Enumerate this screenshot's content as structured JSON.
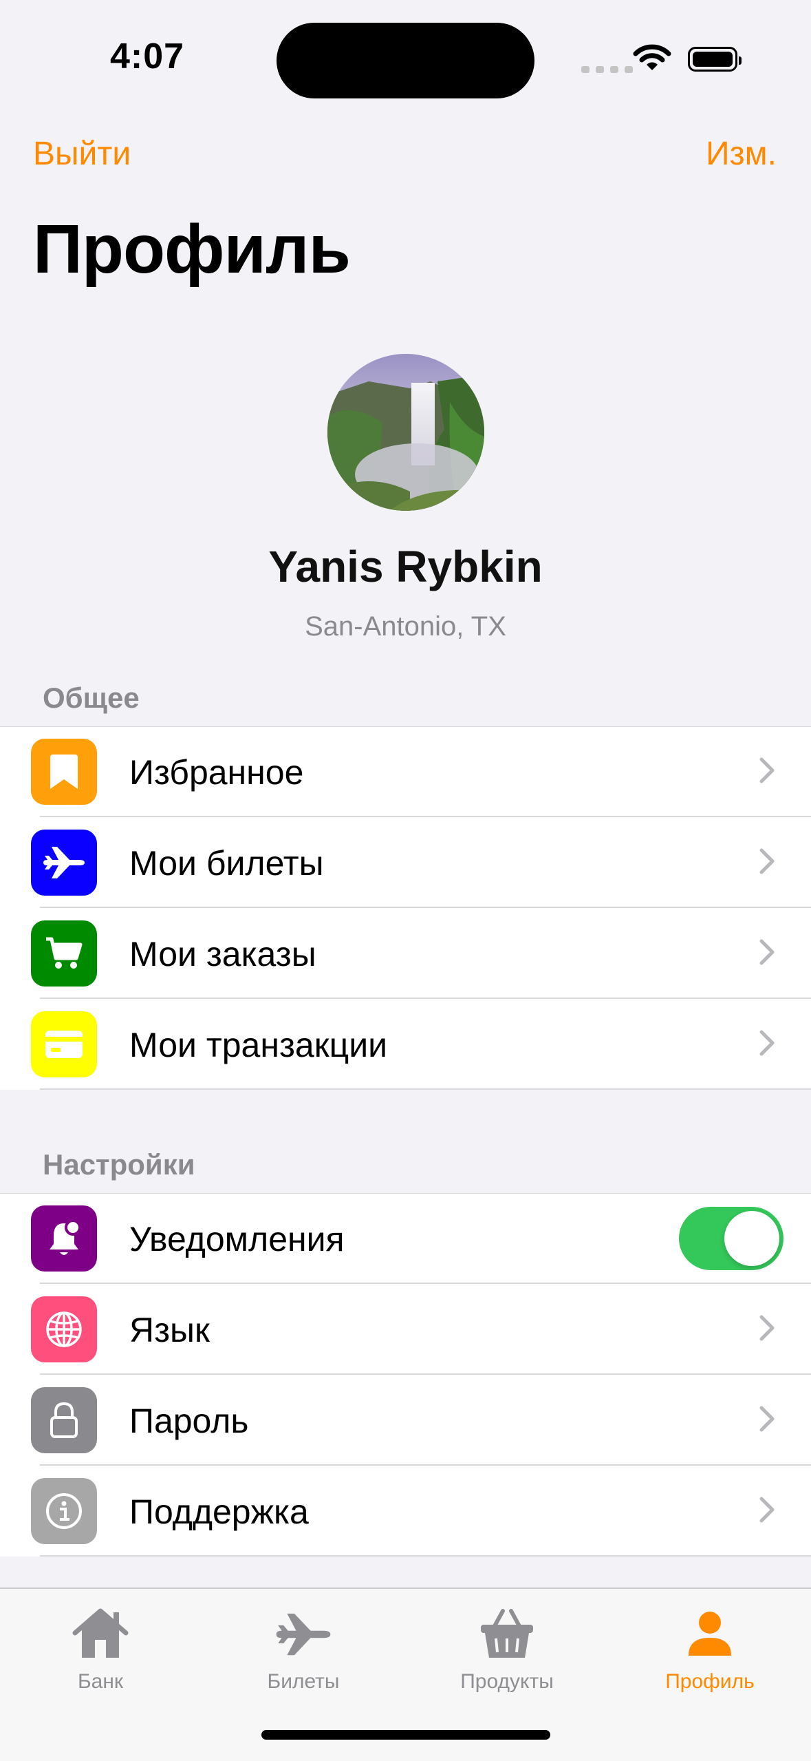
{
  "status_bar": {
    "time": "4:07"
  },
  "nav": {
    "left_button": "Выйти",
    "right_button": "Изм.",
    "title": "Профиль"
  },
  "profile": {
    "name": "Yanis Rybkin",
    "location": "San-Antonio, TX",
    "avatar": "waterfall-photo"
  },
  "sections": {
    "general": {
      "header": "Общее",
      "items": [
        {
          "label": "Избранное",
          "icon": "bookmark-icon",
          "color": "#ff9f0a"
        },
        {
          "label": "Мои билеты",
          "icon": "airplane-icon",
          "color": "#0a00ff"
        },
        {
          "label": "Мои заказы",
          "icon": "cart-icon",
          "color": "#008a00"
        },
        {
          "label": "Мои транзакции",
          "icon": "credit-card-icon",
          "color": "#ffff00"
        }
      ]
    },
    "settings": {
      "header": "Настройки",
      "items": [
        {
          "label": "Уведомления",
          "icon": "bell-badge-icon",
          "color": "#7d0087",
          "toggle": true
        },
        {
          "label": "Язык",
          "icon": "globe-icon",
          "color": "#ff4f7d"
        },
        {
          "label": "Пароль",
          "icon": "lock-icon",
          "color": "#8a8a8e"
        },
        {
          "label": "Поддержка",
          "icon": "info-icon",
          "color": "#a7a7a7"
        }
      ]
    }
  },
  "tab_bar": {
    "tabs": [
      {
        "label": "Банк",
        "icon": "house-icon"
      },
      {
        "label": "Билеты",
        "icon": "airplane-icon"
      },
      {
        "label": "Продукты",
        "icon": "basket-icon"
      },
      {
        "label": "Профиль",
        "icon": "person-icon",
        "active": true
      }
    ],
    "active_color": "#ff8a00"
  },
  "colors": {
    "accent": "#ff8a00",
    "toggle_on": "#34c759"
  }
}
